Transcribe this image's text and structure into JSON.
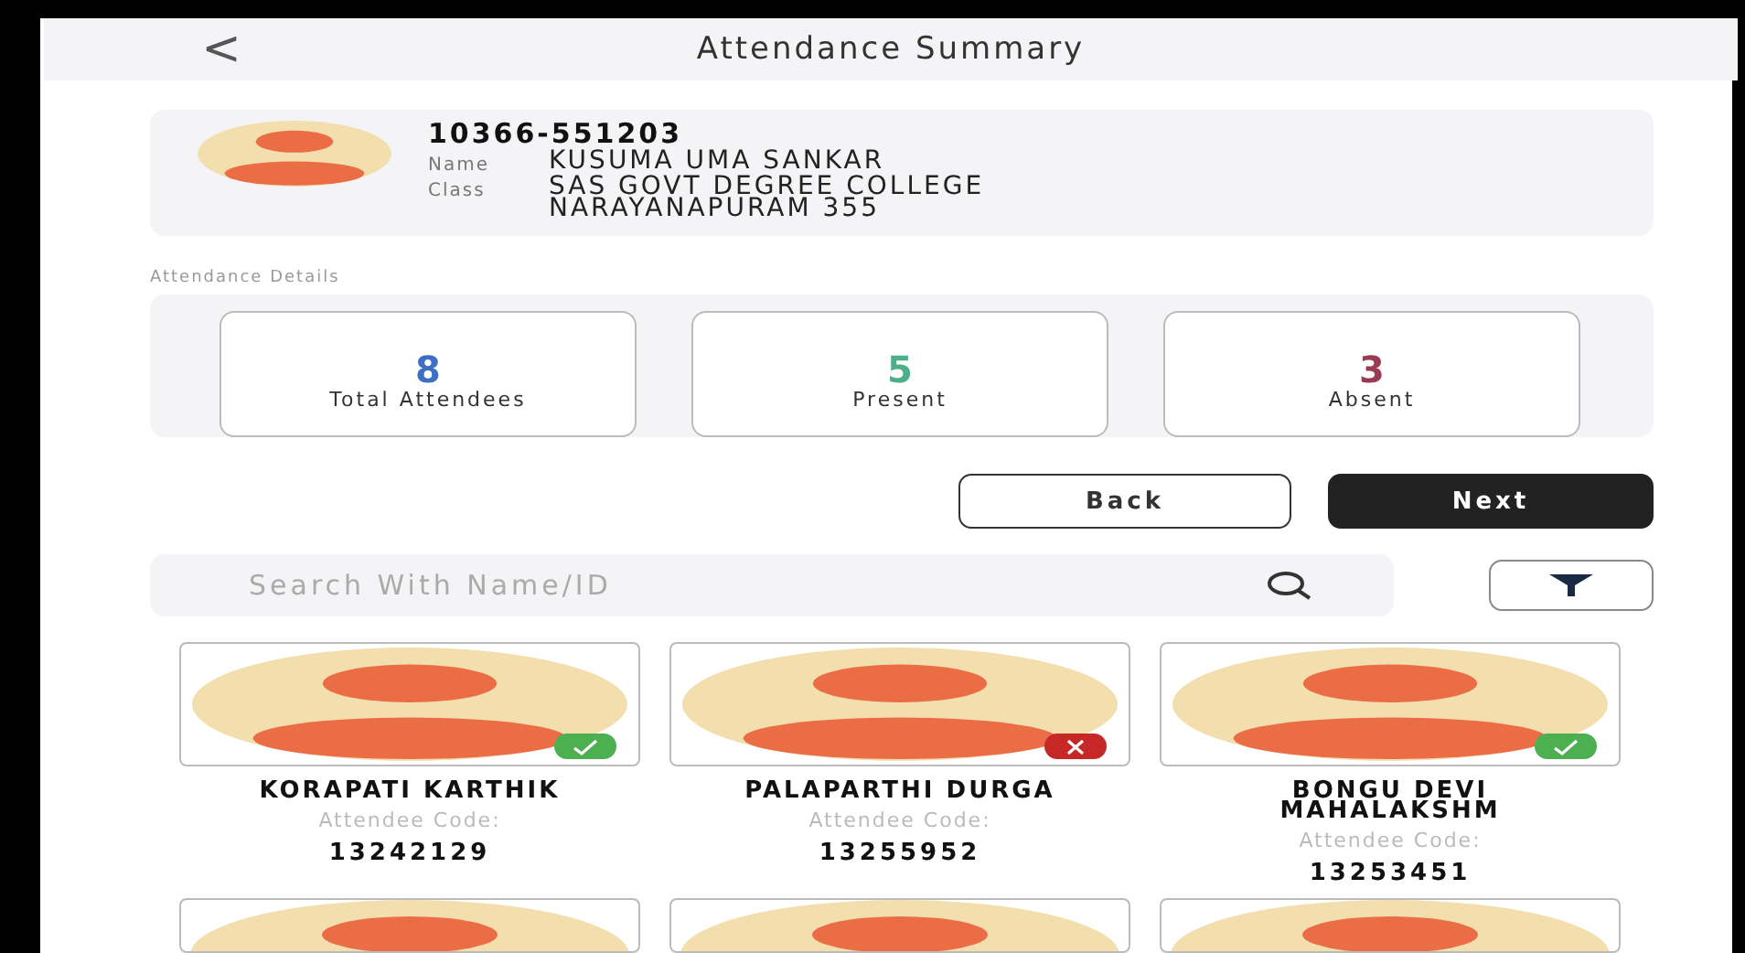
{
  "header": {
    "back": "<",
    "title": "Attendance Summary"
  },
  "profile": {
    "id": "10366-551203",
    "name_label": "Name",
    "name": "KUSUMA UMA SANKAR",
    "class_label": "Class",
    "class": "SAS GOVT DEGREE COLLEGE NARAYANAPURAM 355"
  },
  "details_label": "Attendance Details",
  "stats": [
    {
      "value": "8",
      "label": "Total Attendees",
      "color": "#3d6fc4"
    },
    {
      "value": "5",
      "label": "Present",
      "color": "#4caf8a"
    },
    {
      "value": "3",
      "label": "Absent",
      "color": "#9a3b55"
    }
  ],
  "buttons": [
    {
      "label": "Back",
      "kind": "outline"
    },
    {
      "label": "Next",
      "kind": "filled"
    }
  ],
  "search": {
    "placeholder": "Search With Name/ID"
  },
  "attendees": [
    {
      "name": "KORAPATI KARTHIK",
      "code_label": "Attendee Code:",
      "code": "13242129",
      "present": true
    },
    {
      "name": "PALAPARTHI DURGA",
      "code_label": "Attendee Code:",
      "code": "13255952",
      "present": false
    },
    {
      "name": "BONGU DEVI MAHALAKSHM",
      "code_label": "Attendee Code:",
      "code": "13253451",
      "present": true
    }
  ]
}
